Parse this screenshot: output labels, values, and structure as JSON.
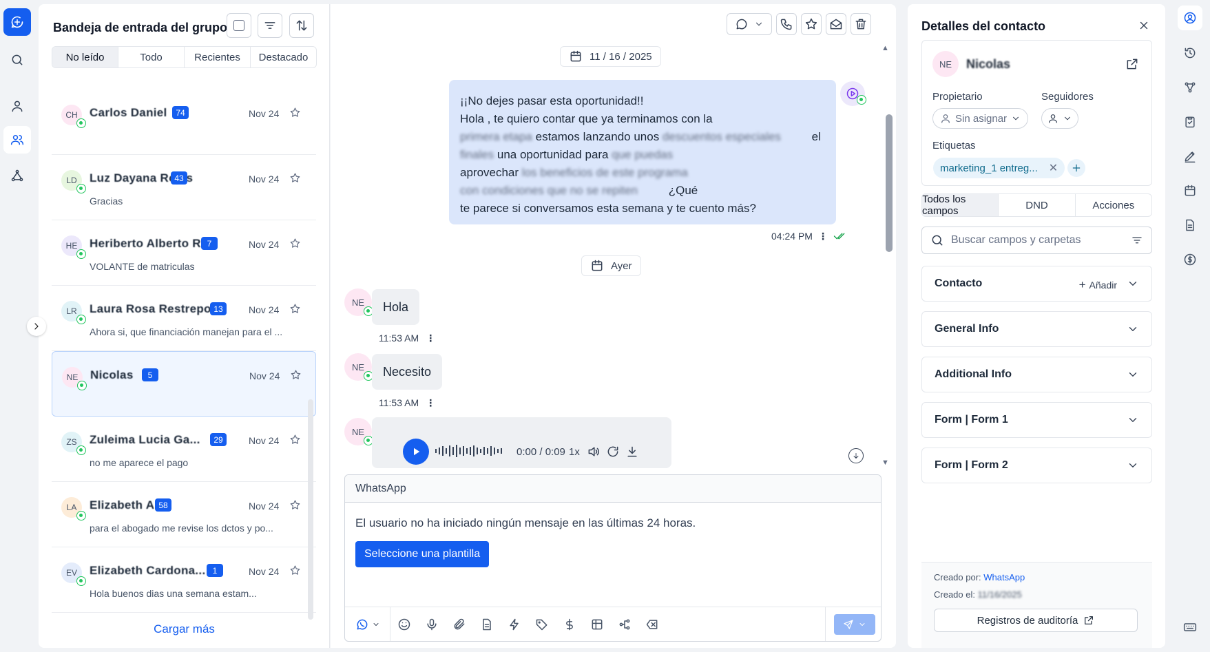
{
  "inbox": {
    "title": "Bandeja de entrada del grupo",
    "tabs": [
      {
        "label": "No leído",
        "active": true
      },
      {
        "label": "Todo",
        "active": false
      },
      {
        "label": "Recientes",
        "active": false
      },
      {
        "label": "Destacado",
        "active": false
      }
    ],
    "load_more": "Cargar más",
    "conversations": [
      {
        "initials": "CH",
        "name": "Carlos Daniel",
        "badge": "74",
        "date": "Nov 24",
        "preview": "",
        "avatar_color": "#fde7f3"
      },
      {
        "initials": "LD",
        "name": "Luz Dayana Rojas",
        "badge": "43",
        "date": "Nov 24",
        "preview": "Gracias",
        "avatar_color": "#e7f6df"
      },
      {
        "initials": "HE",
        "name": "Heriberto Alberto Ruiz...",
        "badge": "7",
        "date": "Nov 24",
        "preview": "VOLANTE de matriculas",
        "avatar_color": "#ece8fb"
      },
      {
        "initials": "LR",
        "name": "Laura Rosa Restrepo...",
        "badge": "13",
        "date": "Nov 24",
        "preview": "Ahora si, que financiación manejan para el ...",
        "avatar_color": "#e1f3f7"
      },
      {
        "initials": "NE",
        "name": "Nicolas",
        "badge": "5",
        "date": "Nov 24",
        "preview": "",
        "avatar_color": "#fde7f3",
        "selected": true
      },
      {
        "initials": "ZS",
        "name": "Zuleima Lucia Ga...",
        "badge": "29",
        "date": "Nov 24",
        "preview": "no me aparece el pago",
        "avatar_color": "#e1f3f7"
      },
      {
        "initials": "LA",
        "name": "Elizabeth A",
        "badge": "58",
        "date": "Nov 24",
        "preview": "para el abogado me revise los dctos y po...",
        "avatar_color": "#fdecd8"
      },
      {
        "initials": "EV",
        "name": "Elizabeth Cardona...",
        "badge": "1",
        "date": "Nov 24",
        "preview": "Hola buenos dias una semana estam...",
        "avatar_color": "#e4ecfb"
      }
    ]
  },
  "chat": {
    "date_first": "11 / 16 / 2025",
    "date_second": "Ayer",
    "outgoing": {
      "lines": [
        "¡¡No dejes pasar esta oportunidad!!",
        "Hola , te quiero contar que ya terminamos con la",
        "el",
        "una oportunidad para",
        "aprovechar",
        "¿Qué",
        "te parece si conversamos esta semana y te cuento más?"
      ],
      "blur_fragments": [
        "primera etapa",
        "estamos lanzando unos",
        "descuentos especiales",
        "finales",
        "que puedas",
        "los beneficios de este programa",
        "con condiciones que no se repiten"
      ],
      "time": "04:24 PM"
    },
    "incoming": [
      {
        "initials": "NE",
        "text": "Hola",
        "time": "11:53 AM"
      },
      {
        "initials": "NE",
        "text": "Necesito",
        "time": "11:53 AM"
      }
    ],
    "audio": {
      "initials": "NE",
      "time": "0:00 / 0:09",
      "rate": "1x"
    },
    "composer": {
      "channel": "WhatsApp",
      "message": "El usuario no ha iniciado ningún mensaje en las últimas 24 horas.",
      "template_button": "Seleccione una plantilla"
    }
  },
  "details": {
    "title": "Detalles del contacto",
    "contact_initials": "NE",
    "contact_name": "Nicolas",
    "owner_label": "Propietario",
    "owner_value": "Sin asignar",
    "followers_label": "Seguidores",
    "tags_label": "Etiquetas",
    "tag": "marketing_1 entreg...",
    "tabs": [
      {
        "label": "Todos los campos",
        "active": true
      },
      {
        "label": "DND",
        "active": false
      },
      {
        "label": "Acciones",
        "active": false
      }
    ],
    "search_placeholder": "Buscar campos y carpetas",
    "sections": [
      {
        "label": "Contacto",
        "add": "Añadir"
      },
      {
        "label": "General Info"
      },
      {
        "label": "Additional Info"
      },
      {
        "label": "Form | Form 1"
      },
      {
        "label": "Form | Form 2"
      }
    ],
    "created_by_label": "Creado por:",
    "created_by_value": "WhatsApp",
    "created_on_label": "Creado el:",
    "created_on_value": "11/16/2025",
    "audit_button": "Registros de auditoría"
  },
  "colors": {
    "accent": "#155eef",
    "outgoing_bubble": "#dbe6fb",
    "whatsapp": "#22c55e"
  }
}
